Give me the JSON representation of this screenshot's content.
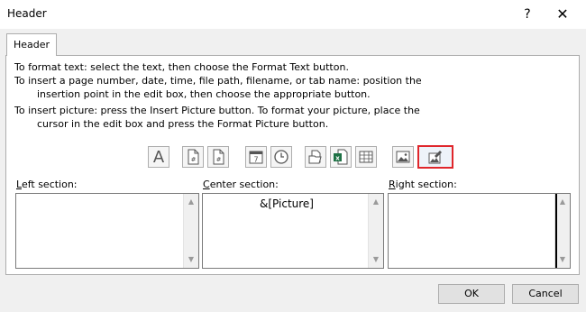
{
  "window": {
    "title": "Header",
    "help_glyph": "?",
    "close_glyph": "✕"
  },
  "tabs": [
    {
      "label": "Header"
    }
  ],
  "instructions": [
    "To format text:  select the text, then choose the Format Text button.",
    "To insert a page number, date, time, file path, filename, or tab name:  position the",
    "insertion point in the edit box, then choose the appropriate button.",
    "To insert picture: press the Insert Picture button.  To format your picture, place the",
    "cursor in the edit box and press the Format Picture button."
  ],
  "toolbar": {
    "buttons": [
      {
        "name": "format-text-button",
        "icon": "format-text-icon",
        "glyph": "A"
      },
      {
        "name": "insert-page-number-button",
        "icon": "page-number-icon"
      },
      {
        "name": "insert-number-of-pages-button",
        "icon": "number-of-pages-icon"
      },
      {
        "name": "insert-date-button",
        "icon": "calendar-icon",
        "glyph": "7"
      },
      {
        "name": "insert-time-button",
        "icon": "clock-icon"
      },
      {
        "name": "insert-file-path-button",
        "icon": "folder-icon"
      },
      {
        "name": "insert-file-name-button",
        "icon": "excel-file-icon"
      },
      {
        "name": "insert-sheet-name-button",
        "icon": "sheet-icon"
      },
      {
        "name": "insert-picture-button",
        "icon": "picture-icon"
      },
      {
        "name": "format-picture-button",
        "icon": "format-picture-icon",
        "highlighted": true
      }
    ]
  },
  "sections": {
    "left": {
      "label_pre": "",
      "label_mnemonic": "L",
      "label_post": "eft section:",
      "content": ""
    },
    "center": {
      "label_pre": "",
      "label_mnemonic": "C",
      "label_post": "enter section:",
      "content": "&[Picture]"
    },
    "right": {
      "label_pre": "",
      "label_mnemonic": "R",
      "label_post": "ight section:",
      "content": ""
    }
  },
  "buttons": {
    "ok": "OK",
    "cancel": "Cancel"
  },
  "colors": {
    "highlight": "#e0262b",
    "excel_green": "#1e7145",
    "icon_gray": "#555555"
  }
}
